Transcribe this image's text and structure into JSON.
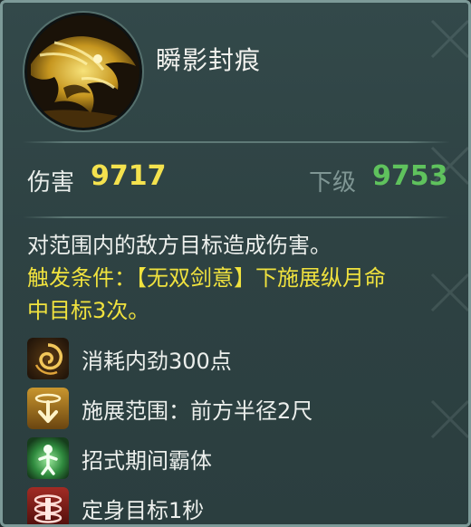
{
  "skill": {
    "name": "瞬影封痕",
    "icon": "golden-dragon-skill-icon"
  },
  "damage": {
    "label": "伤害",
    "value": "9717",
    "next_label": "下级",
    "next_value": "9753"
  },
  "description": {
    "line1": "对范围内的敌方目标造成伤害。",
    "trigger_line1": "触发条件：【无双剑意】下施展纵月命",
    "trigger_line2": "中目标3次。"
  },
  "effects": [
    {
      "icon": "swirl-icon",
      "text": "消耗内劲300点"
    },
    {
      "icon": "range-arrow-icon",
      "text": "施展范围：前方半径2尺"
    },
    {
      "icon": "figure-glow-icon",
      "text": "招式期间霸体"
    },
    {
      "icon": "root-rings-icon",
      "text": "定身目标1秒"
    }
  ],
  "colors": {
    "damage_value": "#f4e24e",
    "next_value": "#5fc25d",
    "trigger_text": "#f0e23e"
  }
}
